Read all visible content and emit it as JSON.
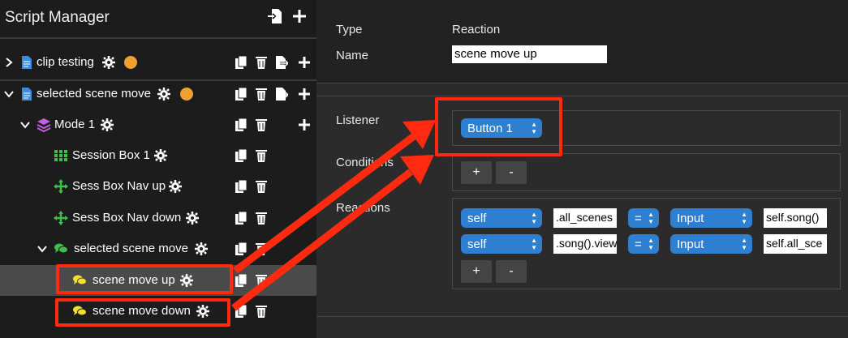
{
  "sidebar": {
    "title": "Script Manager",
    "rows": [
      {
        "label": "clip testing"
      },
      {
        "label": "selected scene move"
      },
      {
        "label": "Mode 1"
      },
      {
        "label": "Session Box 1"
      },
      {
        "label": "Sess Box Nav up"
      },
      {
        "label": "Sess Box Nav down"
      },
      {
        "label": "selected scene move"
      },
      {
        "label": "scene move up"
      },
      {
        "label": "scene move down"
      }
    ]
  },
  "editor": {
    "type_label": "Type",
    "type_value": "Reaction",
    "name_label": "Name",
    "name_value": "scene move up",
    "listener_label": "Listener",
    "listener_value": "Button 1",
    "conditions_label": "Conditions",
    "reactions_label": "Reactions",
    "add_label": "+",
    "remove_label": "-",
    "reactions": [
      {
        "target": "self",
        "attr": ".all_scenes",
        "op": "=",
        "source": "Input",
        "value": "self.song()"
      },
      {
        "target": "self",
        "attr": ".song().view",
        "op": "=",
        "source": "Input",
        "value": "self.all_sce"
      }
    ]
  },
  "colors": {
    "accent": "#2f7fd1",
    "annotation": "#ff2a10",
    "orange_badge": "#f0a030"
  }
}
